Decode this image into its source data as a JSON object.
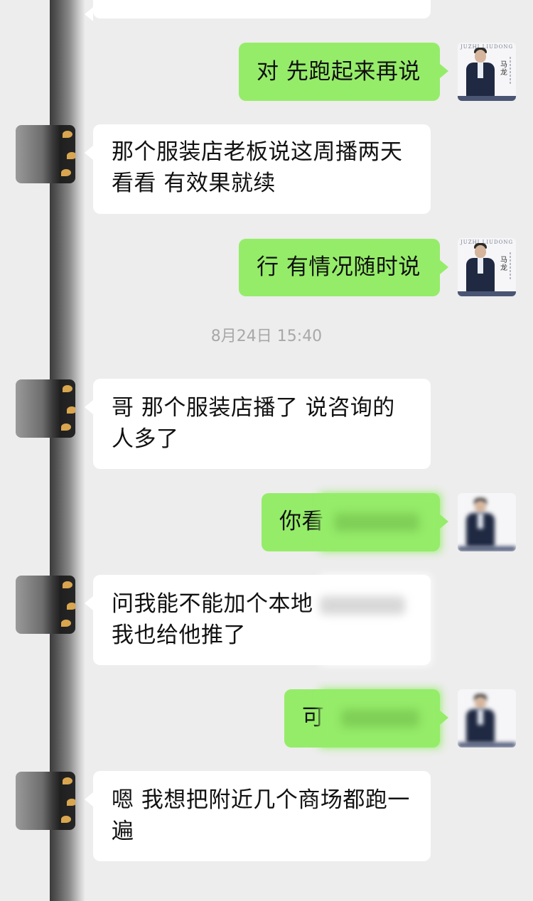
{
  "colors": {
    "background": "#ededed",
    "outgoing_bubble": "#95ec69",
    "incoming_bubble": "#ffffff",
    "timestamp_text": "#a8a8a8"
  },
  "messages": [
    {
      "side": "outgoing",
      "text": "对 先跑起来再说"
    },
    {
      "side": "incoming",
      "text": "那个服装店老板说这周播两天看看 有效果就续"
    },
    {
      "side": "outgoing",
      "text": "行 有情况随时说"
    },
    {
      "side": "incoming",
      "text": "哥 那个服装店播了 说咨询的人多了"
    },
    {
      "side": "outgoing",
      "text": "你看"
    },
    {
      "side": "incoming",
      "text": "问我能不能加个本地",
      "text_line2": "我也给他推了"
    },
    {
      "side": "outgoing",
      "text": "可"
    },
    {
      "side": "incoming",
      "text": "嗯 我想把附近几个商场都跑一遍"
    }
  ],
  "timestamp": "8月24日 15:40",
  "self_avatar": {
    "icon": "business-card-avatar-icon",
    "card_name": "马龙",
    "card_brand": "JUZHI LIUDONG"
  },
  "contact_avatar": {
    "icon": "blurred-contact-avatar-icon"
  }
}
